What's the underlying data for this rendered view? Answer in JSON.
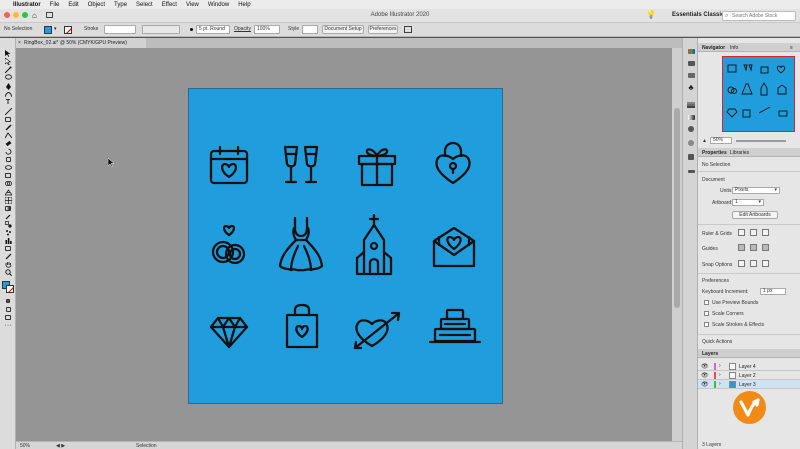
{
  "menubar": {
    "app": "Illustrator",
    "items": [
      "File",
      "Edit",
      "Object",
      "Type",
      "Select",
      "Effect",
      "View",
      "Window",
      "Help"
    ]
  },
  "appbar": {
    "title": "Adobe Illustrator 2020",
    "workspace": "Essentials Classic",
    "search_placeholder": "Search Adobe Stock"
  },
  "control": {
    "selection": "No Selection",
    "stroke_label": "Stroke",
    "brush": "5 pt. Round",
    "opacity_label": "Opacity",
    "opacity_value": "100%",
    "style_label": "Style",
    "doc_setup": "Document Setup",
    "preferences": "Preferences"
  },
  "document_tab": "RingBox_02.ai* @ 50% (CMYK/GPU Preview)",
  "status": {
    "zoom": "50%",
    "tool": "Selection"
  },
  "icons": [
    "calendar-heart-icon",
    "champagne-glasses-icon",
    "gift-box-icon",
    "heart-padlock-icon",
    "rings-icon",
    "wedding-dress-icon",
    "chapel-icon",
    "love-letter-icon",
    "diamond-icon",
    "gift-bag-icon",
    "heart-arrow-icon",
    "wedding-cake-icon"
  ],
  "colors": {
    "artboard": "#209DDC",
    "accent": "#F28A17",
    "selection": "#CFE3F5"
  },
  "panels": {
    "navigator_tabs": [
      "Navigator",
      "Info"
    ],
    "nav_zoom": "50%",
    "properties_tabs": [
      "Properties",
      "Libraries"
    ],
    "no_selection": "No Selection",
    "document_heading": "Document",
    "units_label": "Units:",
    "units_value": "Pixels",
    "artboard_label": "Artboard:",
    "artboard_value": "1",
    "edit_artboards": "Edit Artboards",
    "rulers_grids": "Ruler & Grids",
    "guides": "Guides",
    "snap_options": "Snap Options",
    "preferences_heading": "Preferences",
    "keyboard_increment_label": "Keyboard Increment:",
    "keyboard_increment_value": "1 px",
    "use_preview_bounds": "Use Preview Bounds",
    "scale_corners": "Scale Corners",
    "scale_strokes": "Scale Strokes & Effects",
    "quick_actions": "Quick Actions",
    "layers_tab": "Layers",
    "layers": [
      {
        "name": "Layer 4",
        "color": "#e35fc4"
      },
      {
        "name": "Layer 2",
        "color": "#f0494a"
      },
      {
        "name": "Layer 3",
        "color": "#4fb23b"
      }
    ],
    "layer_count": "3 Layers"
  }
}
